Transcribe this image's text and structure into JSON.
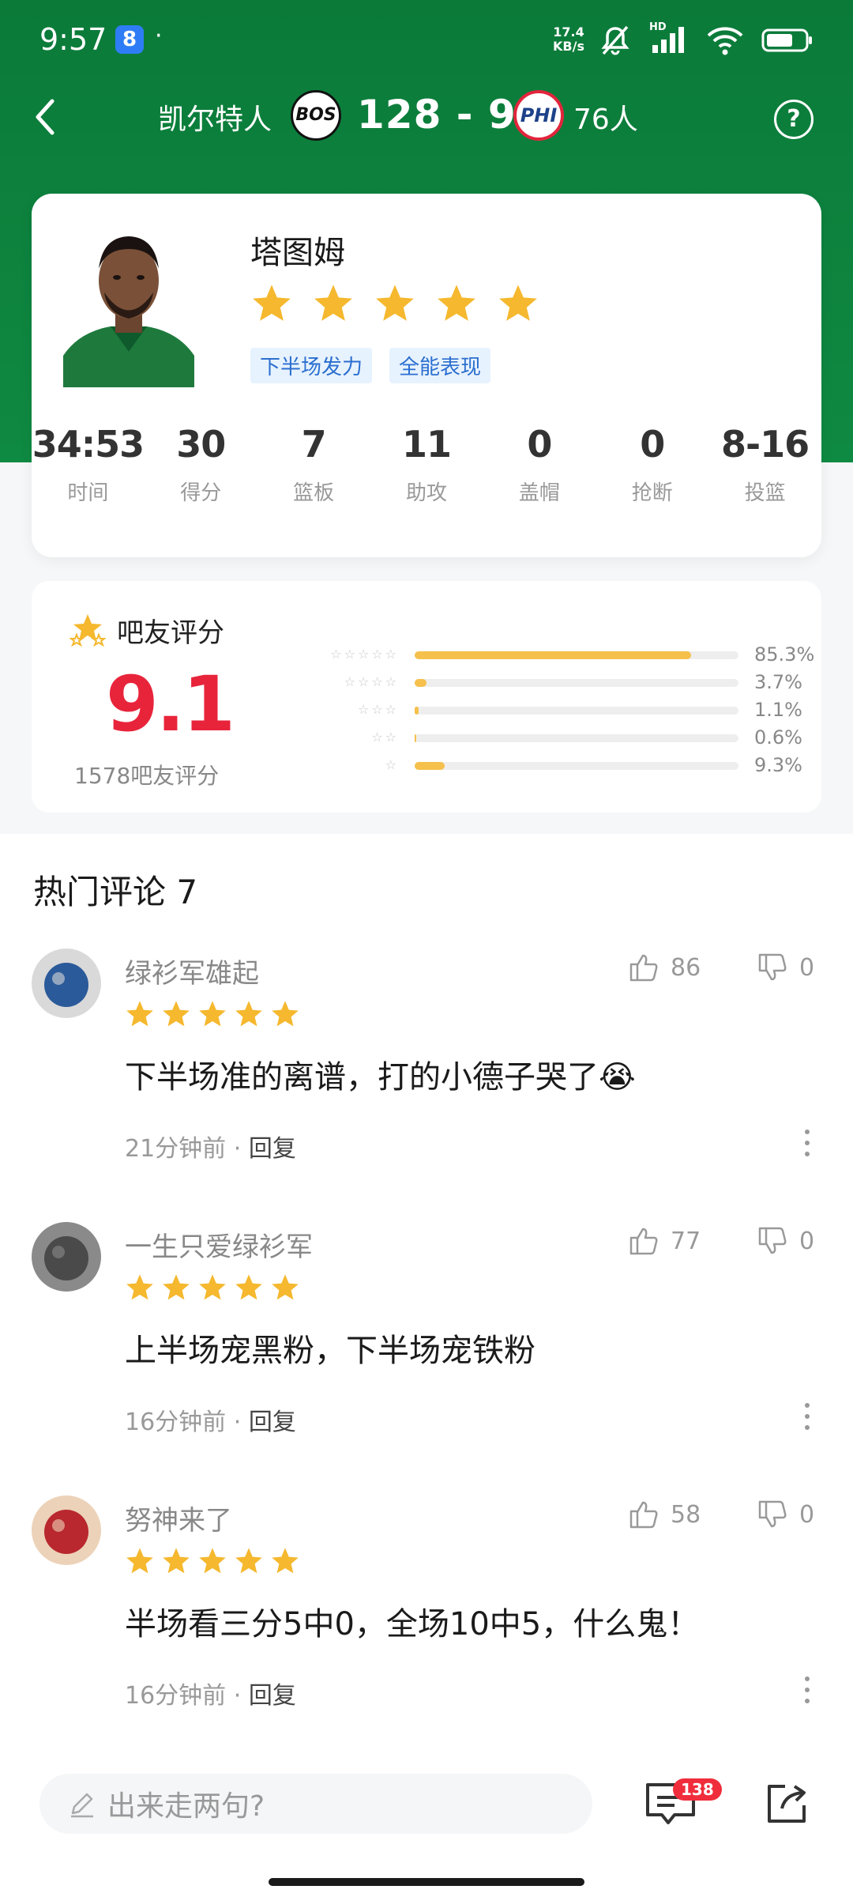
{
  "status_bar": {
    "time": "9:57",
    "app_badge": "8",
    "dot": "·",
    "speed_top": "17.4",
    "speed_bottom": "KB/s",
    "hd_label": "HD"
  },
  "header": {
    "home_team": "凯尔特人",
    "home_logo": "BOS",
    "score": "128 - 96",
    "away_logo": "PHI",
    "away_team": "76人",
    "help": "?"
  },
  "player": {
    "name": "塔图姆",
    "rating_stars": 5,
    "tags": [
      "下半场发力",
      "全能表现"
    ],
    "stats": [
      {
        "value": "34:53",
        "label": "时间"
      },
      {
        "value": "30",
        "label": "得分"
      },
      {
        "value": "7",
        "label": "篮板"
      },
      {
        "value": "11",
        "label": "助攻"
      },
      {
        "value": "0",
        "label": "盖帽"
      },
      {
        "value": "0",
        "label": "抢断"
      },
      {
        "value": "8-16",
        "label": "投篮"
      }
    ]
  },
  "rating": {
    "title": "吧友评分",
    "score": "9.1",
    "count_label": "1578吧友评分",
    "distribution": [
      {
        "stars": "☆☆☆☆☆",
        "percent": 85.3,
        "label": "85.3%"
      },
      {
        "stars": "☆☆☆☆",
        "percent": 3.7,
        "label": "3.7%"
      },
      {
        "stars": "☆☆☆",
        "percent": 1.1,
        "label": "1.1%"
      },
      {
        "stars": "☆☆",
        "percent": 0.6,
        "label": "0.6%"
      },
      {
        "stars": "☆",
        "percent": 9.3,
        "label": "9.3%"
      }
    ]
  },
  "comments_section": {
    "title": "热门评论 7",
    "items": [
      {
        "user": "绿衫军雄起",
        "stars": 5,
        "text": "下半场准的离谱，打的小德子哭了",
        "emoji": "😭",
        "time": "21分钟前",
        "dot": "·",
        "reply": "回复",
        "likes": "86",
        "dislikes": "0"
      },
      {
        "user": "一生只爱绿衫军",
        "stars": 5,
        "text": "上半场宠黑粉，下半场宠铁粉",
        "emoji": "",
        "time": "16分钟前",
        "dot": "·",
        "reply": "回复",
        "likes": "77",
        "dislikes": "0"
      },
      {
        "user": "努神来了",
        "stars": 5,
        "text": "半场看三分5中0，全场10中5，什么鬼！",
        "emoji": "",
        "time": "16分钟前",
        "dot": "·",
        "reply": "回复",
        "likes": "58",
        "dislikes": "0"
      }
    ]
  },
  "bottom_bar": {
    "input_placeholder": "出来走两句?",
    "message_badge": "138"
  },
  "colors": {
    "header_green": "#0f8a42",
    "star_gold": "#f5b82e",
    "rating_red": "#e8243b",
    "tag_blue": "#2b6fcf"
  }
}
